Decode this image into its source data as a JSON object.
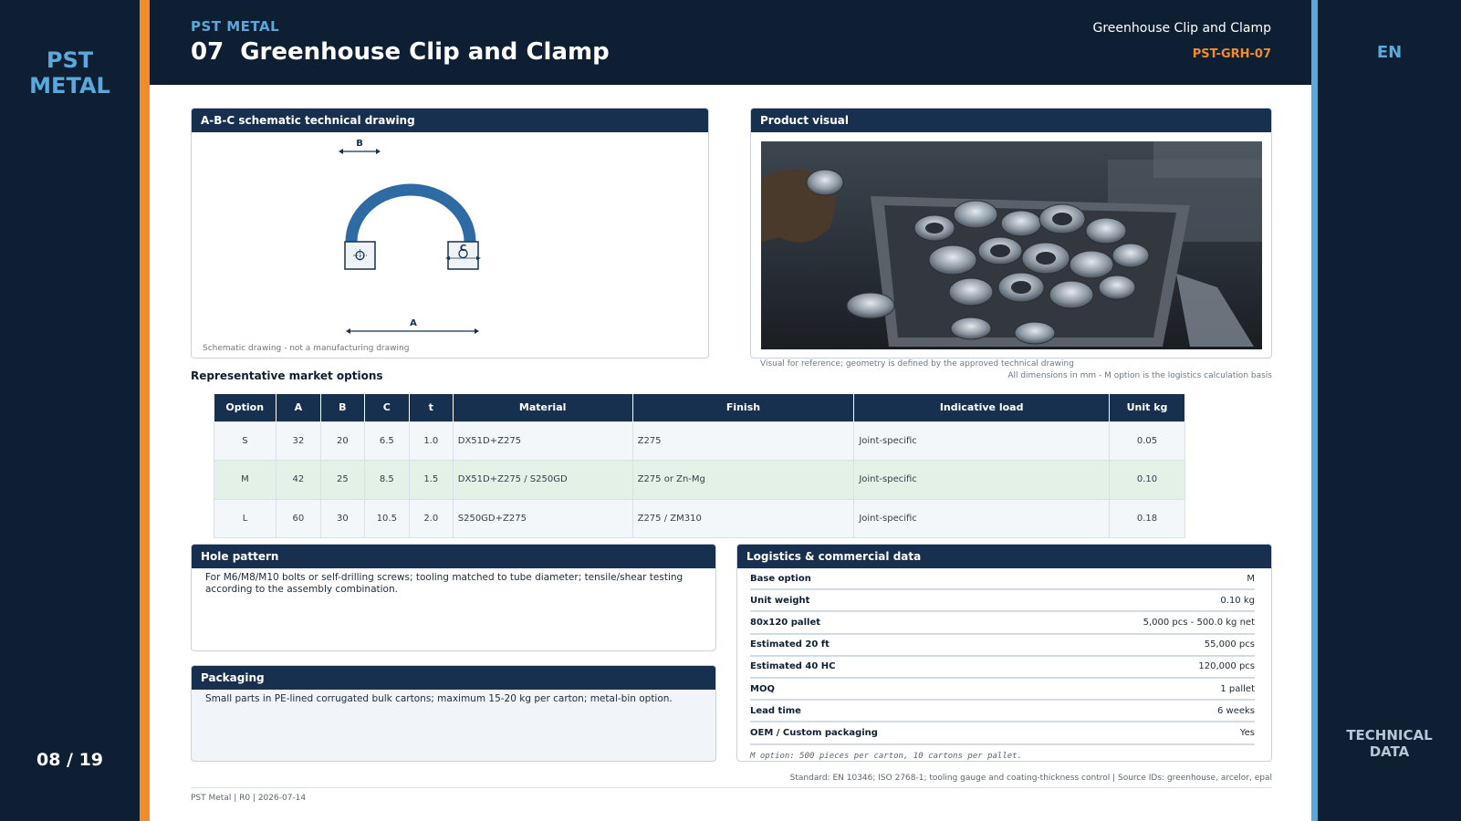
{
  "brand": {
    "line1": "PST",
    "line2": "METAL"
  },
  "page_counter": "08 / 19",
  "language": "EN",
  "right_rail": {
    "line1": "TECHNICAL",
    "line2": "DATA"
  },
  "header": {
    "kicker": "PST METAL",
    "number": "07",
    "title": "Greenhouse Clip and Clamp",
    "right_title": "Greenhouse Clip and Clamp",
    "code": "PST-GRH-07"
  },
  "drawing": {
    "heading": "A-B-C schematic technical drawing",
    "label_a": "A",
    "label_b": "B",
    "label_c": "C",
    "note": "Schematic drawing - not a manufacturing drawing"
  },
  "visual": {
    "heading": "Product visual",
    "note": "Visual for reference; geometry is defined by the approved technical drawing",
    "dims_note": "All dimensions in mm - M option is the logistics calculation basis"
  },
  "options": {
    "title": "Representative market options",
    "columns": [
      "Option",
      "A",
      "B",
      "C",
      "t",
      "Material",
      "Finish",
      "Indicative load",
      "Unit kg"
    ],
    "rows": [
      [
        "S",
        "32",
        "20",
        "6.5",
        "1.0",
        "DX51D+Z275",
        "Z275",
        "Joint-specific",
        "0.05"
      ],
      [
        "M",
        "42",
        "25",
        "8.5",
        "1.5",
        "DX51D+Z275 / S250GD",
        "Z275 or Zn-Mg",
        "Joint-specific",
        "0.10"
      ],
      [
        "L",
        "60",
        "30",
        "10.5",
        "2.0",
        "S250GD+Z275",
        "Z275 / ZM310",
        "Joint-specific",
        "0.18"
      ]
    ]
  },
  "hole_pattern": {
    "heading": "Hole pattern",
    "text": "For M6/M8/M10 bolts or self-drilling screws; tooling matched to tube diameter; tensile/shear testing according to the assembly combination."
  },
  "packaging": {
    "heading": "Packaging",
    "text": "Small parts in PE-lined corrugated bulk cartons; maximum 15-20 kg per carton; metal-bin option."
  },
  "logistics": {
    "heading": "Logistics & commercial data",
    "rows": [
      {
        "key": "Base option",
        "value": "M"
      },
      {
        "key": "Unit weight",
        "value": "0.10 kg"
      },
      {
        "key": "80x120 pallet",
        "value": "5,000 pcs - 500.0 kg net"
      },
      {
        "key": "Estimated 20 ft",
        "value": "55,000 pcs"
      },
      {
        "key": "Estimated 40 HC",
        "value": "120,000 pcs"
      },
      {
        "key": "MOQ",
        "value": "1 pallet"
      },
      {
        "key": "Lead time",
        "value": "6 weeks"
      },
      {
        "key": "OEM / Custom packaging",
        "value": "Yes"
      }
    ],
    "note": "M option: 500 pieces per carton, 10 cartons per pallet."
  },
  "standard": "Standard: EN 10346; ISO 2768-1; tooling gauge and coating-thickness control | Source IDs: greenhouse, arcelor, epal",
  "footer": "PST Metal | R0 | 2026-07-14",
  "colors": {
    "navy": "#0f1f33",
    "panel_head": "#17304f",
    "accent_orange": "#f28c28",
    "accent_blue": "#5aa9dc",
    "highlight_row": "#e3f1e6"
  }
}
